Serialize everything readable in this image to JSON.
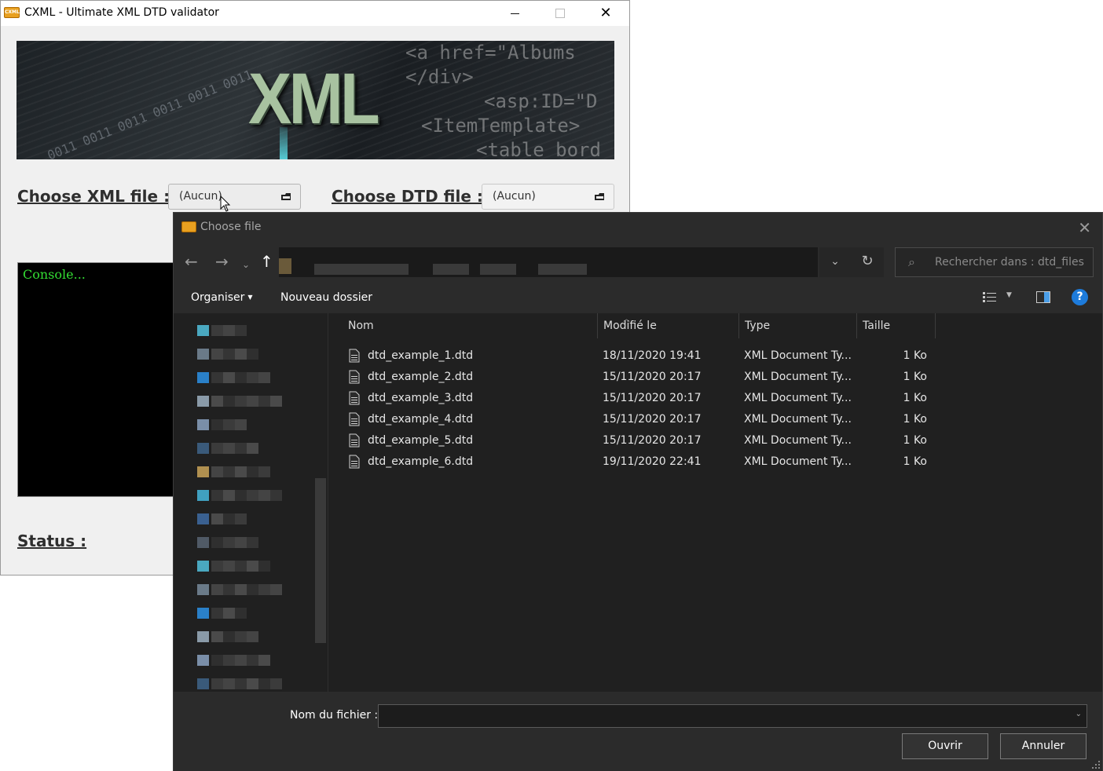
{
  "app": {
    "title": "CXML - Ultimate XML DTD validator",
    "icon_label": "CXML",
    "banner": {
      "logo_text": "XML",
      "code_lines": [
        "<a href=\"Albums",
        "</div>",
        "<asp:ID=\"D",
        "<ItemTemplate>",
        "<table bord"
      ],
      "bits_text": "0011 0011 0011 0011 0011 0011"
    },
    "xml_label": "Choose XML file :",
    "xml_value": "(Aucun)",
    "dtd_label": "Choose DTD file :",
    "dtd_value": "(Aucun)",
    "console_text": "Console...",
    "status_label": "Status :"
  },
  "dialog": {
    "title": "Choose file",
    "search_placeholder": "Rechercher dans : dtd_files",
    "toolbar": {
      "organize": "Organiser",
      "new_folder": "Nouveau dossier"
    },
    "columns": {
      "name": "Nom",
      "modified": "Modifié le",
      "type": "Type",
      "size": "Taille"
    },
    "files": [
      {
        "name": "dtd_example_1.dtd",
        "modified": "18/11/2020 19:41",
        "type": "XML Document Ty...",
        "size": "1 Ko"
      },
      {
        "name": "dtd_example_2.dtd",
        "modified": "15/11/2020 20:17",
        "type": "XML Document Ty...",
        "size": "1 Ko"
      },
      {
        "name": "dtd_example_3.dtd",
        "modified": "15/11/2020 20:17",
        "type": "XML Document Ty...",
        "size": "1 Ko"
      },
      {
        "name": "dtd_example_4.dtd",
        "modified": "15/11/2020 20:17",
        "type": "XML Document Ty...",
        "size": "1 Ko"
      },
      {
        "name": "dtd_example_5.dtd",
        "modified": "15/11/2020 20:17",
        "type": "XML Document Ty...",
        "size": "1 Ko"
      },
      {
        "name": "dtd_example_6.dtd",
        "modified": "19/11/2020 22:41",
        "type": "XML Document Ty...",
        "size": "1 Ko"
      }
    ],
    "filename_label": "Nom du fichier :",
    "filename_value": "",
    "open_label": "Ouvrir",
    "cancel_label": "Annuler"
  },
  "colors": {
    "accent_help": "#1d7bdb",
    "console_text": "#33dd33",
    "dialog_bg": "#202020"
  }
}
